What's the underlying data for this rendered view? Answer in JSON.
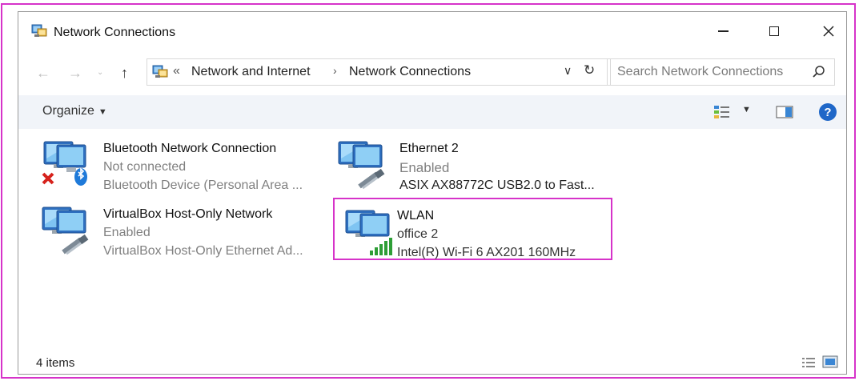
{
  "window": {
    "title": "Network Connections"
  },
  "address": {
    "segments": [
      "Network and Internet",
      "Network Connections"
    ],
    "overflow": "«",
    "separator": "›"
  },
  "search": {
    "placeholder": "Search Network Connections"
  },
  "toolbar": {
    "organize_label": "Organize",
    "help_label": "?"
  },
  "items": [
    {
      "name": "Bluetooth Network Connection",
      "status": "Not connected",
      "device": "Bluetooth Device (Personal Area ...",
      "icon": "bluetooth-network-icon"
    },
    {
      "name": "Ethernet 2",
      "status": "Enabled",
      "device": "ASIX AX88772C USB2.0 to Fast...",
      "icon": "ethernet-network-icon"
    },
    {
      "name": "VirtualBox Host-Only Network",
      "status": "Enabled",
      "device": "VirtualBox Host-Only Ethernet Ad...",
      "icon": "ethernet-network-icon"
    },
    {
      "name": "WLAN",
      "status": "office 2",
      "device": "Intel(R) Wi-Fi 6 AX201 160MHz",
      "icon": "wifi-network-icon",
      "highlighted": true
    }
  ],
  "statusbar": {
    "count": "4 items"
  },
  "colors": {
    "highlight": "#d633c9",
    "toolbar_bg": "#f1f4f9",
    "help_blue": "#1f67c8",
    "signal_green": "#2e9e36"
  }
}
